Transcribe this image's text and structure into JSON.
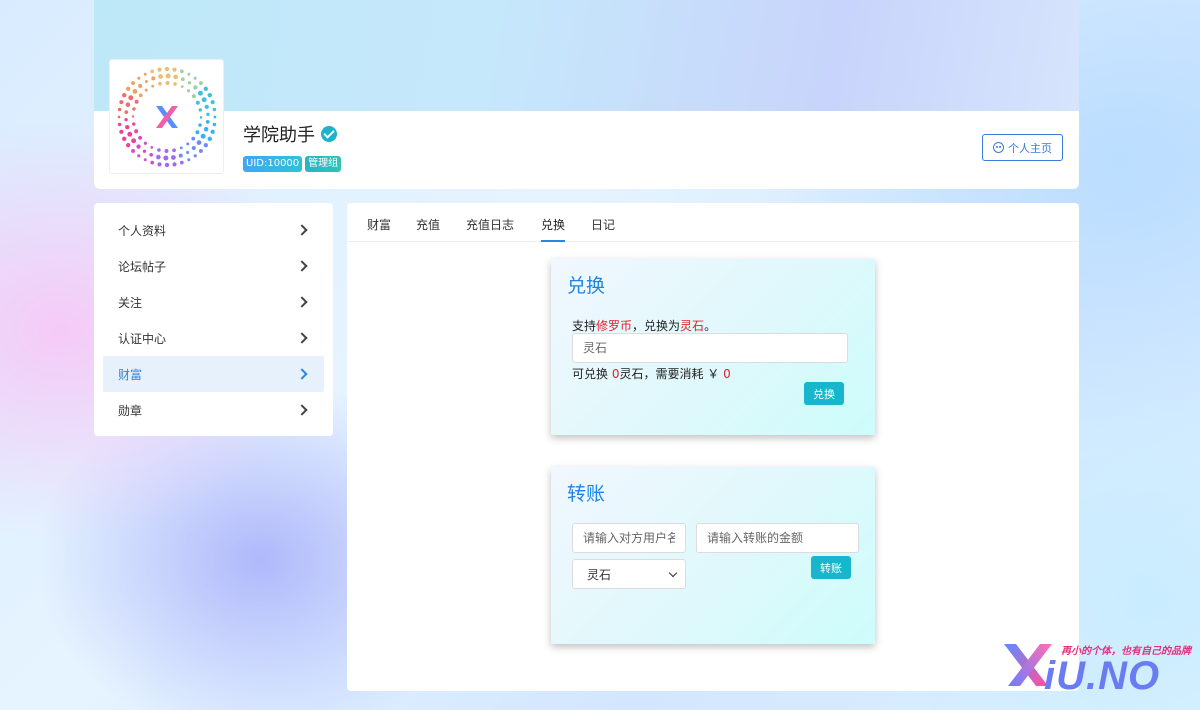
{
  "profile": {
    "name": "学院助手",
    "uid_badge": "UID:10000",
    "group_badge": "管理组",
    "homepage_button": "个人主页"
  },
  "sidebar": {
    "items": [
      {
        "label": "个人资料"
      },
      {
        "label": "论坛帖子"
      },
      {
        "label": "关注"
      },
      {
        "label": "认证中心"
      },
      {
        "label": "财富",
        "active": true
      },
      {
        "label": "勋章"
      }
    ]
  },
  "tabs": [
    {
      "label": "财富"
    },
    {
      "label": "充值"
    },
    {
      "label": "充值日志"
    },
    {
      "label": "兑换",
      "active": true
    },
    {
      "label": "日记"
    }
  ],
  "exchange": {
    "title": "兑换",
    "desc_prefix": "支持",
    "source_currency": "修罗币",
    "desc_middle": "，兑换为",
    "target_currency": "灵石",
    "desc_suffix": "。",
    "input_placeholder": "灵石",
    "info_prefix": "可兑换 ",
    "exchangeable_amount": "0",
    "info_middle": "灵石，需要消耗 ￥ ",
    "cost_amount": "0",
    "button": "兑换"
  },
  "transfer": {
    "title": "转账",
    "username_placeholder": "请输入对方用户名",
    "amount_placeholder": "请输入转账的金额",
    "currency_selected": "灵石",
    "button": "转账"
  },
  "watermark": {
    "tagline": "再小的个体，也有自己的品牌",
    "brand": "iU.NO"
  },
  "colors": {
    "accent": "#2a86e0",
    "button": "#17b6cc",
    "highlight": "#e0202a"
  }
}
